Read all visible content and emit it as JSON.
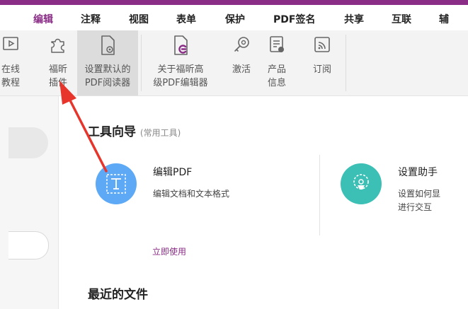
{
  "menu": [
    {
      "label": "编辑",
      "active": true
    },
    {
      "label": "注释"
    },
    {
      "label": "视图"
    },
    {
      "label": "表单"
    },
    {
      "label": "保护"
    },
    {
      "label": "PDF签名"
    },
    {
      "label": "共享"
    },
    {
      "label": "互联"
    },
    {
      "label": "辅"
    }
  ],
  "ribbon": {
    "online_tutorial": "在线\n教程",
    "plugins": "福昕\n插件",
    "set_default_reader": "设置默认的\nPDF阅读器",
    "about_editor": "关于福昕高\n级PDF编辑器",
    "activate": "激活",
    "product_info": "产品\n信息",
    "subscribe": "订阅"
  },
  "tool_guide": {
    "title": "工具向导",
    "subtitle": "(常用工具)"
  },
  "cards": {
    "edit_pdf": {
      "title": "编辑PDF",
      "desc": "编辑文档和文本格式"
    },
    "setup_assistant": {
      "title": "设置助手",
      "desc": "设置如何显\n进行交互"
    }
  },
  "use_now": "立即使用",
  "recent_files": "最近的文件",
  "colors": {
    "brand": "#8a2d86",
    "blue_circle": "#5da9f5",
    "teal_circle": "#3cbfb4",
    "arrow": "#e8352b"
  }
}
